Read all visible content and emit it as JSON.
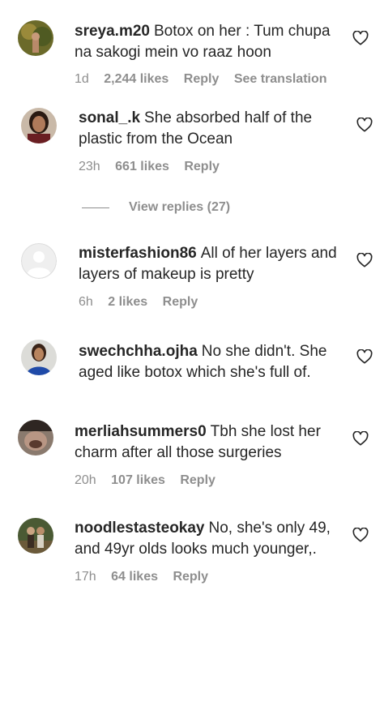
{
  "comments": [
    {
      "username": "sreya.m20",
      "text": "Botox on her : Tum chupa na sakogi mein vo raaz hoon",
      "time": "1d",
      "likes": "2,244 likes",
      "reply": "Reply",
      "translate": "See translation"
    },
    {
      "username": "sonal_.k",
      "text": "She absorbed half of the plastic from the Ocean",
      "time": "23h",
      "likes": "661 likes",
      "reply": "Reply"
    },
    {
      "username": "misterfashion86",
      "text": "All of her layers and layers of makeup is pretty",
      "time": "6h",
      "likes": "2 likes",
      "reply": "Reply"
    },
    {
      "username": "swechchha.ojha",
      "text": "No she didn't. She aged like botox which she's full of.",
      "time": "",
      "likes": "",
      "reply": ""
    },
    {
      "username": "merliahsummers0",
      "text": "Tbh she lost her charm after all those surgeries",
      "time": "20h",
      "likes": "107 likes",
      "reply": "Reply"
    },
    {
      "username": "noodlestasteokay",
      "text": "No, she's only 49, and 49yr olds looks much younger,.",
      "time": "17h",
      "likes": "64 likes",
      "reply": "Reply"
    }
  ],
  "view_replies": "View replies (27)",
  "icons": {
    "like": "heart-outline-icon",
    "default_avatar": "default-avatar-icon"
  }
}
